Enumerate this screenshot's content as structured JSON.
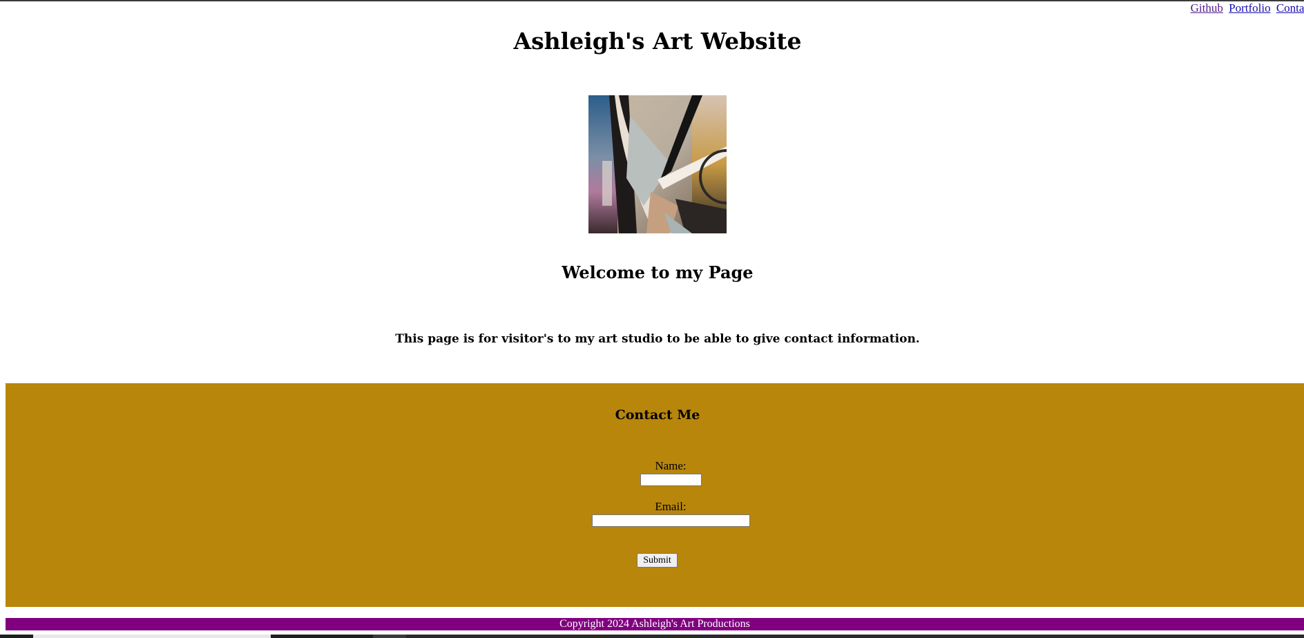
{
  "nav": {
    "links": [
      {
        "label": "Github"
      },
      {
        "label": "Portfolio"
      },
      {
        "label": "Contac"
      }
    ]
  },
  "header": {
    "title": "Ashleigh's Art Website"
  },
  "hero": {
    "image_icon": "abstract-artwork-image"
  },
  "main": {
    "welcome": "Welcome to my Page",
    "intro": "This page is for visitor's to my art studio to be able to give contact information."
  },
  "contact": {
    "heading": "Contact Me",
    "name_label": "Name:",
    "name_value": "",
    "email_label": "Email:",
    "email_value": "",
    "submit_label": "Submit"
  },
  "footer": {
    "copyright": "Copyright 2024 Ashleigh's Art Productions"
  },
  "colors": {
    "contact_bg": "#b8860b",
    "footer_bg": "#800080",
    "link": "#1a0dab",
    "visited_link": "#551a8b"
  }
}
